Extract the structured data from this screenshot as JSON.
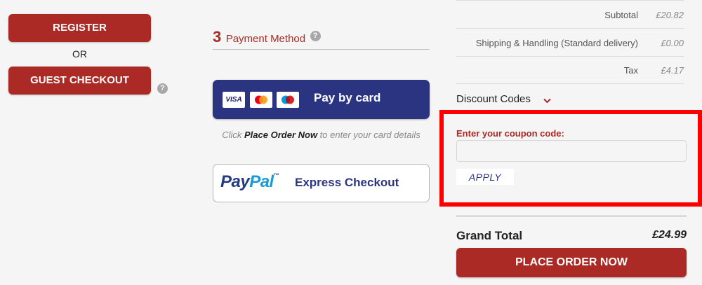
{
  "account": {
    "register_label": "REGISTER",
    "or_label": "OR",
    "guest_label": "GUEST CHECKOUT",
    "help_glyph": "?"
  },
  "payment": {
    "step_number": "3",
    "title": "Payment Method",
    "help_glyph": "?",
    "card_button": {
      "label": "Pay by card",
      "logos": [
        "VISA",
        "mastercard",
        "maestro"
      ]
    },
    "card_hint": {
      "prefix": "Click ",
      "emphasis": "Place Order Now",
      "suffix": " to enter your card details"
    },
    "paypal_button": {
      "logo_part1": "Pay",
      "logo_part2": "Pal",
      "logo_tm": "™",
      "label": "Express Checkout"
    }
  },
  "summary": {
    "rows": [
      {
        "label": "Subtotal",
        "value": "£20.82"
      },
      {
        "label": "Shipping & Handling (Standard delivery)",
        "value": "£0.00"
      },
      {
        "label": "Tax",
        "value": "£4.17"
      }
    ],
    "discount": {
      "heading": "Discount Codes",
      "chevron": "⌄",
      "coupon_label": "Enter your coupon code:",
      "coupon_value": "",
      "coupon_placeholder": "",
      "apply_label": "APPLY"
    },
    "grand_total_label": "Grand Total",
    "grand_total_value": "£24.99",
    "place_order_label": "PLACE ORDER NOW"
  },
  "colors": {
    "brand_red": "#ab2a25",
    "card_blue": "#2b3480",
    "highlight_red": "#ff0000",
    "paypal_dark": "#253b80",
    "paypal_light": "#179bd7"
  },
  "icons": [
    "help-icon",
    "visa-icon",
    "mastercard-icon",
    "maestro-icon",
    "chevron-down-icon",
    "paypal-logo"
  ]
}
